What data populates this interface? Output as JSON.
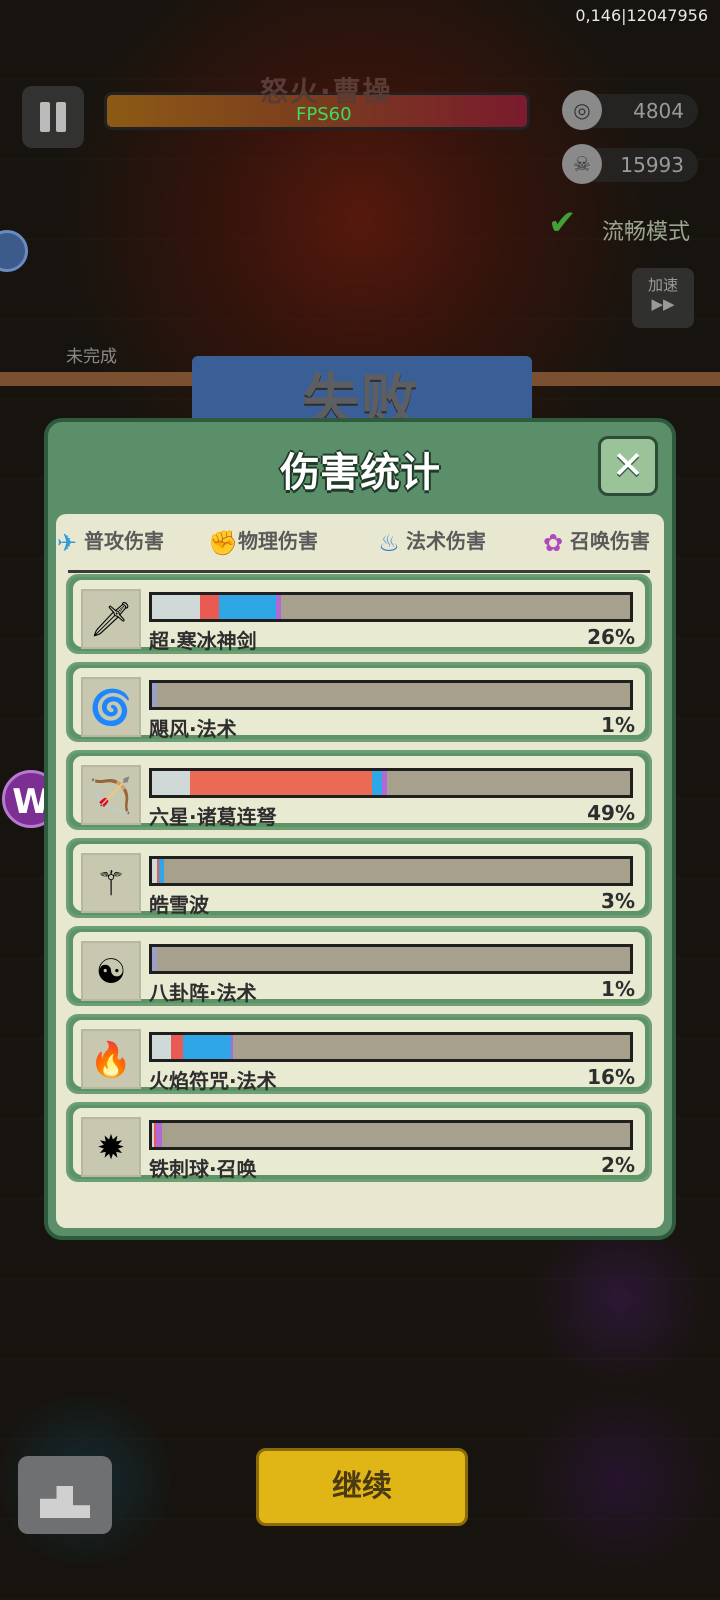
{
  "hud": {
    "coords": "0,146|12047956",
    "boss_name": "怒火·曹操",
    "fps": "FPS60",
    "coins": "4804",
    "kills": "15993",
    "smooth_mode": "流畅模式",
    "speed_label": "加速",
    "unfinished": "未完成"
  },
  "banner": {
    "title": "失败"
  },
  "panel": {
    "title": "伤害统计",
    "close": "✕",
    "legend": [
      {
        "label": "普攻伤害",
        "icon": "sword-icon",
        "color": "#2f9bd8"
      },
      {
        "label": "物理伤害",
        "icon": "fist-icon",
        "color": "#e23b34"
      },
      {
        "label": "法术伤害",
        "icon": "flame-icon",
        "color": "#2f7ad8"
      },
      {
        "label": "召唤伤害",
        "icon": "paw-icon",
        "color": "#b048c0"
      }
    ],
    "rows": [
      {
        "name": "超·寒冰神剑",
        "percent": "26%",
        "icon": "ice-sword-icon",
        "segments": [
          {
            "c": "#cfd9d8",
            "w": 0.1
          },
          {
            "c": "#e85a52",
            "w": 0.04
          },
          {
            "c": "#2fa6e6",
            "w": 0.12
          },
          {
            "c": "#b069d6",
            "w": 0.01
          }
        ]
      },
      {
        "name": "飓风·法术",
        "percent": "1%",
        "icon": "tornado-icon",
        "segments": [
          {
            "c": "#9aa0c6",
            "w": 0.01
          }
        ]
      },
      {
        "name": "六星·诸葛连弩",
        "percent": "49%",
        "icon": "crossbow-icon",
        "segments": [
          {
            "c": "#cfd9d8",
            "w": 0.08
          },
          {
            "c": "#ea6a55",
            "w": 0.38
          },
          {
            "c": "#2fa6e6",
            "w": 0.02
          },
          {
            "c": "#b069d6",
            "w": 0.01
          }
        ]
      },
      {
        "name": "皓雪波",
        "percent": "3%",
        "icon": "snow-scepter-icon",
        "segments": [
          {
            "c": "#cfd9d8",
            "w": 0.01
          },
          {
            "c": "#e85a52",
            "w": 0.005
          },
          {
            "c": "#2fa6e6",
            "w": 0.01
          }
        ]
      },
      {
        "name": "八卦阵·法术",
        "percent": "1%",
        "icon": "bagua-icon",
        "segments": [
          {
            "c": "#9aa0c6",
            "w": 0.01
          }
        ]
      },
      {
        "name": "火焰符咒·法术",
        "percent": "16%",
        "icon": "fire-talisman-icon",
        "segments": [
          {
            "c": "#cfd9d8",
            "w": 0.04
          },
          {
            "c": "#e85a52",
            "w": 0.025
          },
          {
            "c": "#2fa6e6",
            "w": 0.1
          },
          {
            "c": "#b069d6",
            "w": 0.005
          }
        ]
      },
      {
        "name": "铁刺球·召唤",
        "percent": "2%",
        "icon": "spike-ball-icon",
        "segments": [
          {
            "c": "#cfd9d8",
            "w": 0.005
          },
          {
            "c": "#e85a52",
            "w": 0.005
          },
          {
            "c": "#b069d6",
            "w": 0.012
          }
        ]
      }
    ]
  },
  "footer": {
    "continue": "继续"
  }
}
